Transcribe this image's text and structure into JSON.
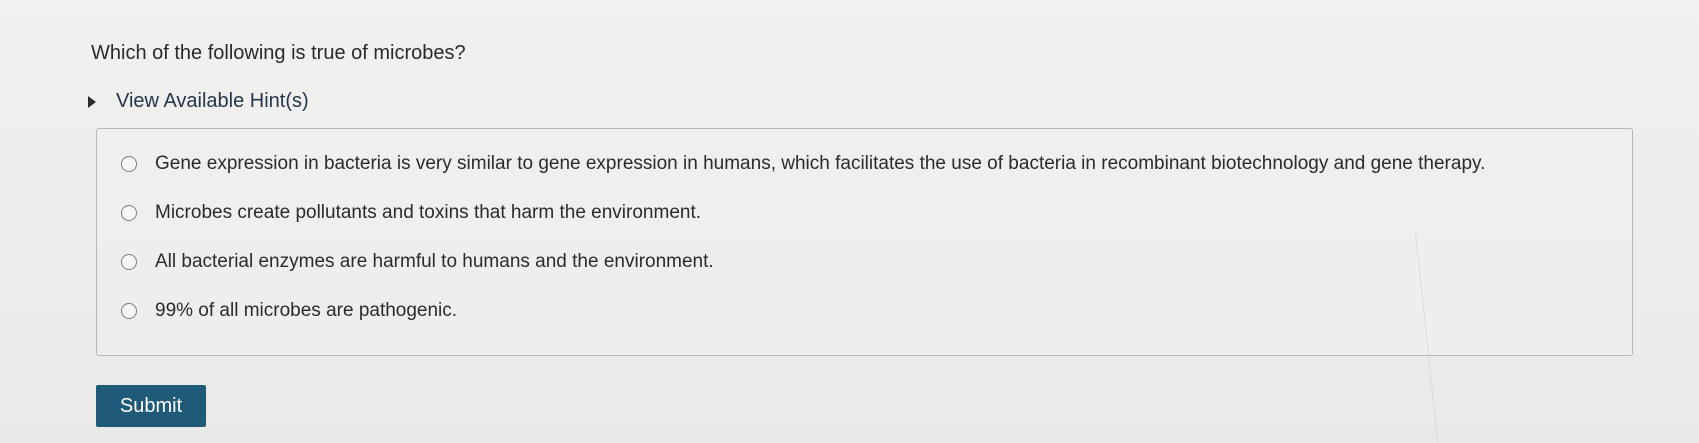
{
  "question": {
    "text": "Which of the following is true of microbes?"
  },
  "hints": {
    "label": "View Available Hint(s)"
  },
  "options": [
    {
      "label": "Gene expression in bacteria is very similar to gene expression in humans, which facilitates the use of bacteria in recombinant biotechnology and gene therapy."
    },
    {
      "label": "Microbes create pollutants and toxins that harm the environment."
    },
    {
      "label": "All bacterial enzymes are harmful to humans and the environment."
    },
    {
      "label": "99% of all microbes are pathogenic."
    }
  ],
  "submit": {
    "label": "Submit"
  },
  "colors": {
    "submit_bg": "#1f5b79",
    "hint_text": "#24364a"
  }
}
